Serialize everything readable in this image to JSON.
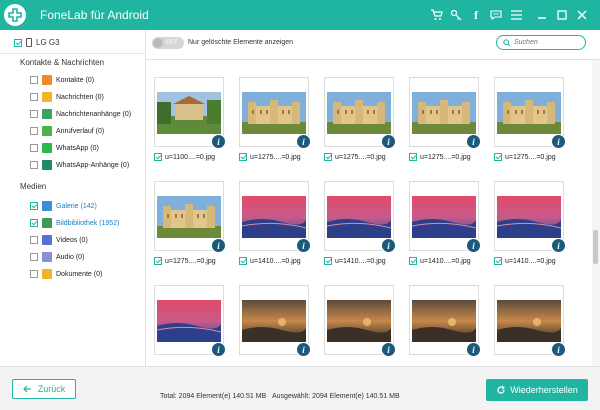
{
  "app": {
    "title": "FoneLab für Android"
  },
  "titlebar_icons": [
    "cart-icon",
    "key-icon",
    "facebook-icon",
    "feedback-icon",
    "menu-icon",
    "minimize-icon",
    "maximize-icon",
    "close-icon"
  ],
  "sidebar": {
    "device": "LG G3",
    "section_contacts": "Kontakte & Nachrichten",
    "contacts_items": [
      {
        "label": "Kontakte (0)",
        "icon": "contacts-icon",
        "color": "#f08a24"
      },
      {
        "label": "Nachrichten (0)",
        "icon": "messages-icon",
        "color": "#f0b428"
      },
      {
        "label": "Nachrichtenanhänge (0)",
        "icon": "attachments-icon",
        "color": "#3aa55a"
      },
      {
        "label": "Anrufverlauf (0)",
        "icon": "call-log-icon",
        "color": "#4db048"
      },
      {
        "label": "WhatsApp (0)",
        "icon": "whatsapp-icon",
        "color": "#2fb84a"
      },
      {
        "label": "WhatsApp-Anhänge (0)",
        "icon": "whatsapp-attachments-icon",
        "color": "#1e8a6a"
      }
    ],
    "section_media": "Medien",
    "media_items": [
      {
        "label": "Galerie (142)",
        "icon": "gallery-icon",
        "color": "#3a8fd8",
        "checked": true
      },
      {
        "label": "Bildbibliothek (1952)",
        "icon": "picture-library-icon",
        "color": "#3b9a5a",
        "checked": true
      },
      {
        "label": "Videos (0)",
        "icon": "videos-icon",
        "color": "#5a6fd0",
        "checked": false
      },
      {
        "label": "Audio (0)",
        "icon": "audio-icon",
        "color": "#8a8fd8",
        "checked": false
      },
      {
        "label": "Dokumente (0)",
        "icon": "documents-icon",
        "color": "#f0b428",
        "checked": false
      }
    ]
  },
  "topbar": {
    "toggle_label": "OFF",
    "toggle_text": "Nur gelöschte Elemente anzeigen",
    "search_placeholder": "Suchen"
  },
  "tiles": [
    {
      "caption": "u=1100....=0.jpg",
      "scene": "villa"
    },
    {
      "caption": "u=1275....=0.jpg",
      "scene": "palace"
    },
    {
      "caption": "u=1275....=0.jpg",
      "scene": "palace"
    },
    {
      "caption": "u=1275....=0.jpg",
      "scene": "palace"
    },
    {
      "caption": "u=1275....=0.jpg",
      "scene": "palace"
    },
    {
      "caption": "u=1275....=0.jpg",
      "scene": "palace"
    },
    {
      "caption": "u=1410....=0.jpg",
      "scene": "sunset"
    },
    {
      "caption": "u=1410....=0.jpg",
      "scene": "sunset"
    },
    {
      "caption": "u=1410....=0.jpg",
      "scene": "sunset"
    },
    {
      "caption": "u=1410....=0.jpg",
      "scene": "sunset"
    },
    {
      "caption": "",
      "scene": "sunset"
    },
    {
      "caption": "",
      "scene": "dusk"
    },
    {
      "caption": "",
      "scene": "dusk"
    },
    {
      "caption": "",
      "scene": "dusk"
    },
    {
      "caption": "",
      "scene": "dusk"
    }
  ],
  "bottombar": {
    "back_label": "Zurück",
    "total_text": "Total: 2094 Element(e) 140.51 MB",
    "selected_text": "Ausgewählt: 2094 Element(e) 140.51 MB",
    "restore_label": "Wiederherstellen"
  },
  "colors": {
    "accent": "#1fb5a1",
    "info_badge": "#1b5a7a",
    "link": "#1b7fc4"
  }
}
